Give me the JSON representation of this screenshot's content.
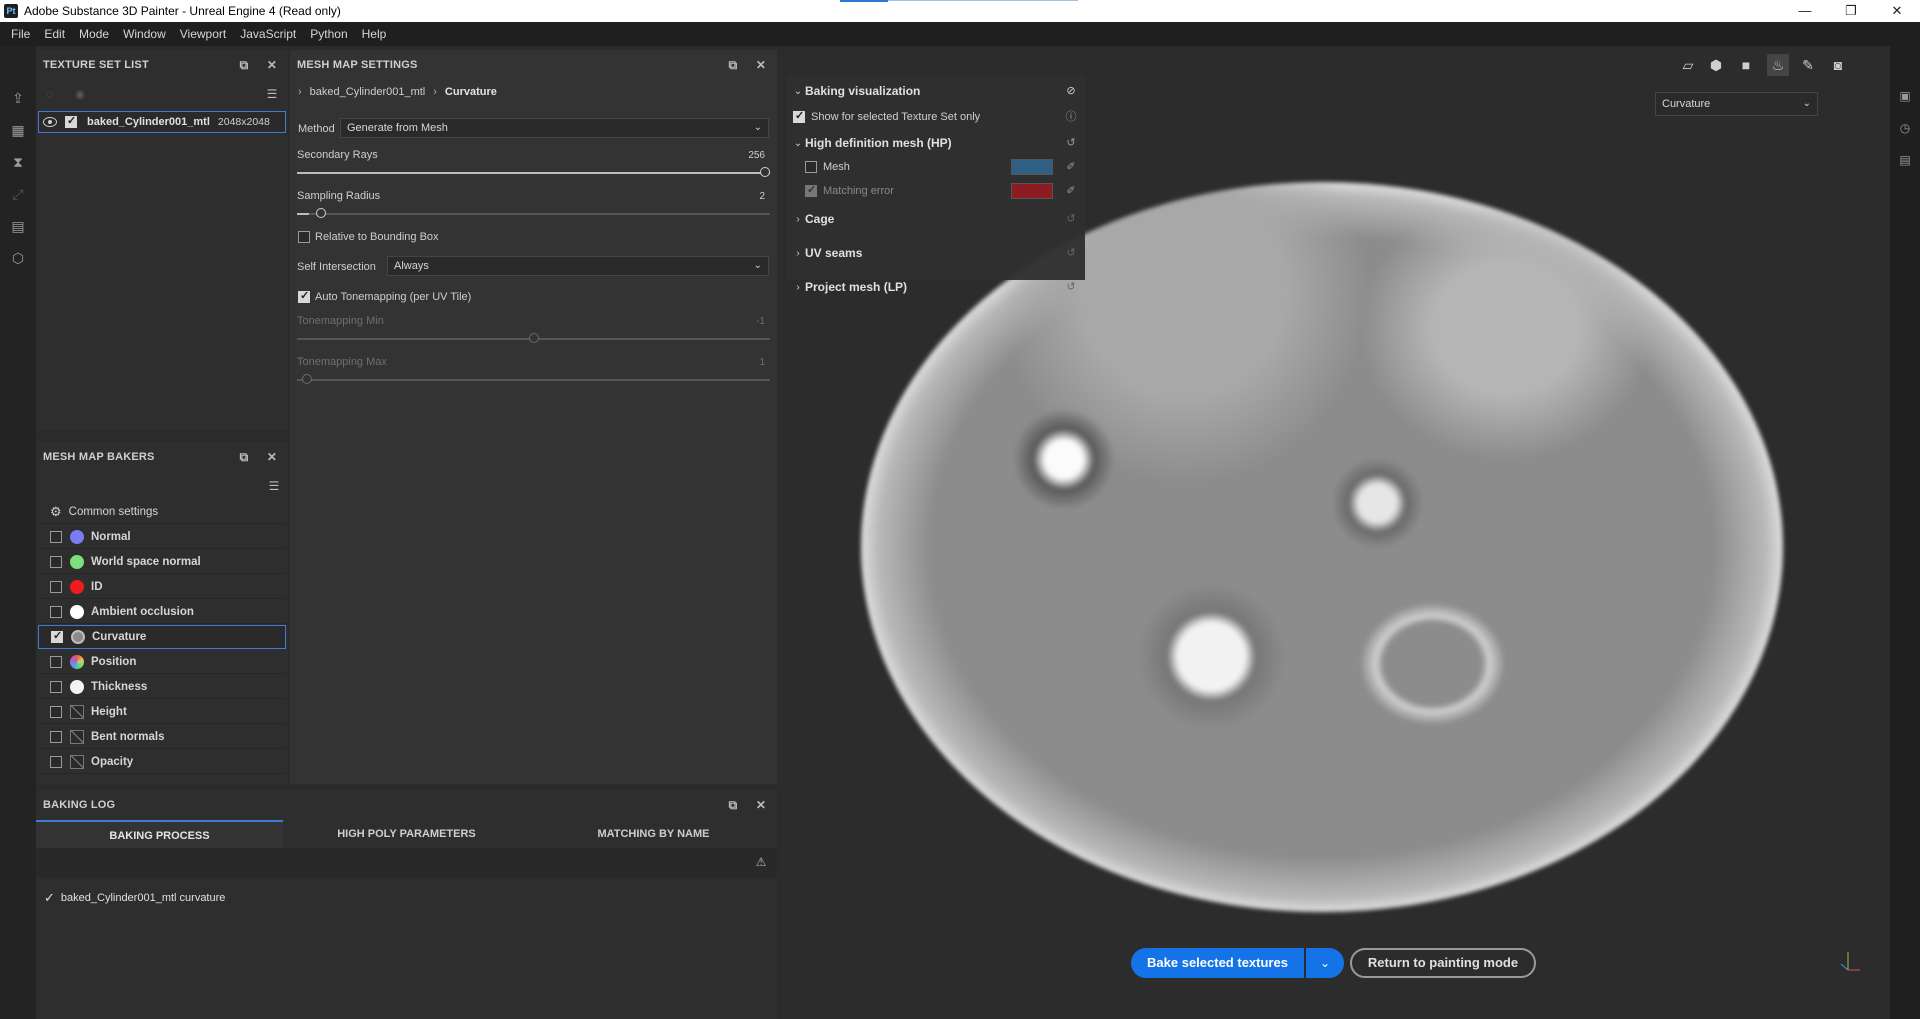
{
  "window": {
    "title": "Adobe Substance 3D Painter - Unreal Engine 4 (Read only)",
    "app_icon": "Pt",
    "controls": [
      "—",
      "❐",
      "✕"
    ]
  },
  "menu": [
    "File",
    "Edit",
    "Mode",
    "Window",
    "Viewport",
    "JavaScript",
    "Python",
    "Help"
  ],
  "texture_set_list": {
    "title": "TEXTURE SET LIST",
    "item": {
      "name": "baked_Cylinder001_mtl",
      "resolution": "2048x2048"
    }
  },
  "mesh_map_bakers": {
    "title": "MESH MAP BAKERS",
    "common": "Common settings",
    "items": [
      {
        "label": "Normal",
        "checked": false,
        "color": "#7b7bf2"
      },
      {
        "label": "World space normal",
        "checked": false,
        "color": "#7ce07c"
      },
      {
        "label": "ID",
        "checked": false,
        "color": "#ee1c1c"
      },
      {
        "label": "Ambient occlusion",
        "checked": false,
        "color": "#ffffff"
      },
      {
        "label": "Curvature",
        "checked": true,
        "color": "#8a8a8a"
      },
      {
        "label": "Position",
        "checked": false,
        "color": "#e08a3c"
      },
      {
        "label": "Thickness",
        "checked": false,
        "color": "#f4f4f4"
      },
      {
        "label": "Height",
        "checked": false,
        "color": ""
      },
      {
        "label": "Bent normals",
        "checked": false,
        "color": ""
      },
      {
        "label": "Opacity",
        "checked": false,
        "color": ""
      }
    ]
  },
  "mesh_map_settings": {
    "title": "MESH MAP SETTINGS",
    "breadcrumb_parent": "baked_Cylinder001_mtl",
    "breadcrumb_current": "Curvature",
    "method_label": "Method",
    "method_value": "Generate from Mesh",
    "secondary_rays_label": "Secondary Rays",
    "secondary_rays_value": "256",
    "secondary_rays_fraction": 1.0,
    "sampling_radius_label": "Sampling Radius",
    "sampling_radius_value": "2",
    "sampling_radius_fraction": 0.02,
    "relative_bbox_label": "Relative to Bounding Box",
    "relative_bbox_checked": false,
    "self_intersection_label": "Self Intersection",
    "self_intersection_value": "Always",
    "auto_tonemapping_label": "Auto Tonemapping (per UV Tile)",
    "auto_tonemapping_checked": true,
    "tonemapping_min_label": "Tonemapping Min",
    "tonemapping_min_value": "-1",
    "tonemapping_min_fraction": 0.5,
    "tonemapping_max_label": "Tonemapping Max",
    "tonemapping_max_value": "1",
    "tonemapping_max_fraction": 0.0
  },
  "baking_log": {
    "title": "BAKING LOG",
    "tabs": [
      "BAKING PROCESS",
      "HIGH POLY PARAMETERS",
      "MATCHING BY NAME"
    ],
    "active_tab": 0,
    "entry": "baked_Cylinder001_mtl curvature"
  },
  "viewport": {
    "display_select": "Curvature",
    "baking_visualization": {
      "title": "Baking visualization",
      "show_selected_label": "Show for selected Texture Set only",
      "show_selected_checked": true,
      "hp_section": "High definition mesh (HP)",
      "mesh_label": "Mesh",
      "mesh_checked": false,
      "mesh_color": "#2f5f82",
      "matching_error_label": "Matching error",
      "matching_error_checked": true,
      "matching_error_color": "#8a1c22",
      "cage_label": "Cage",
      "uv_seams_label": "UV seams",
      "project_mesh_label": "Project mesh (LP)"
    },
    "bake_button": "Bake selected textures",
    "return_button": "Return to painting mode"
  },
  "colors": {
    "accent": "#1473e6",
    "selection_border": "#3c7bd6"
  }
}
